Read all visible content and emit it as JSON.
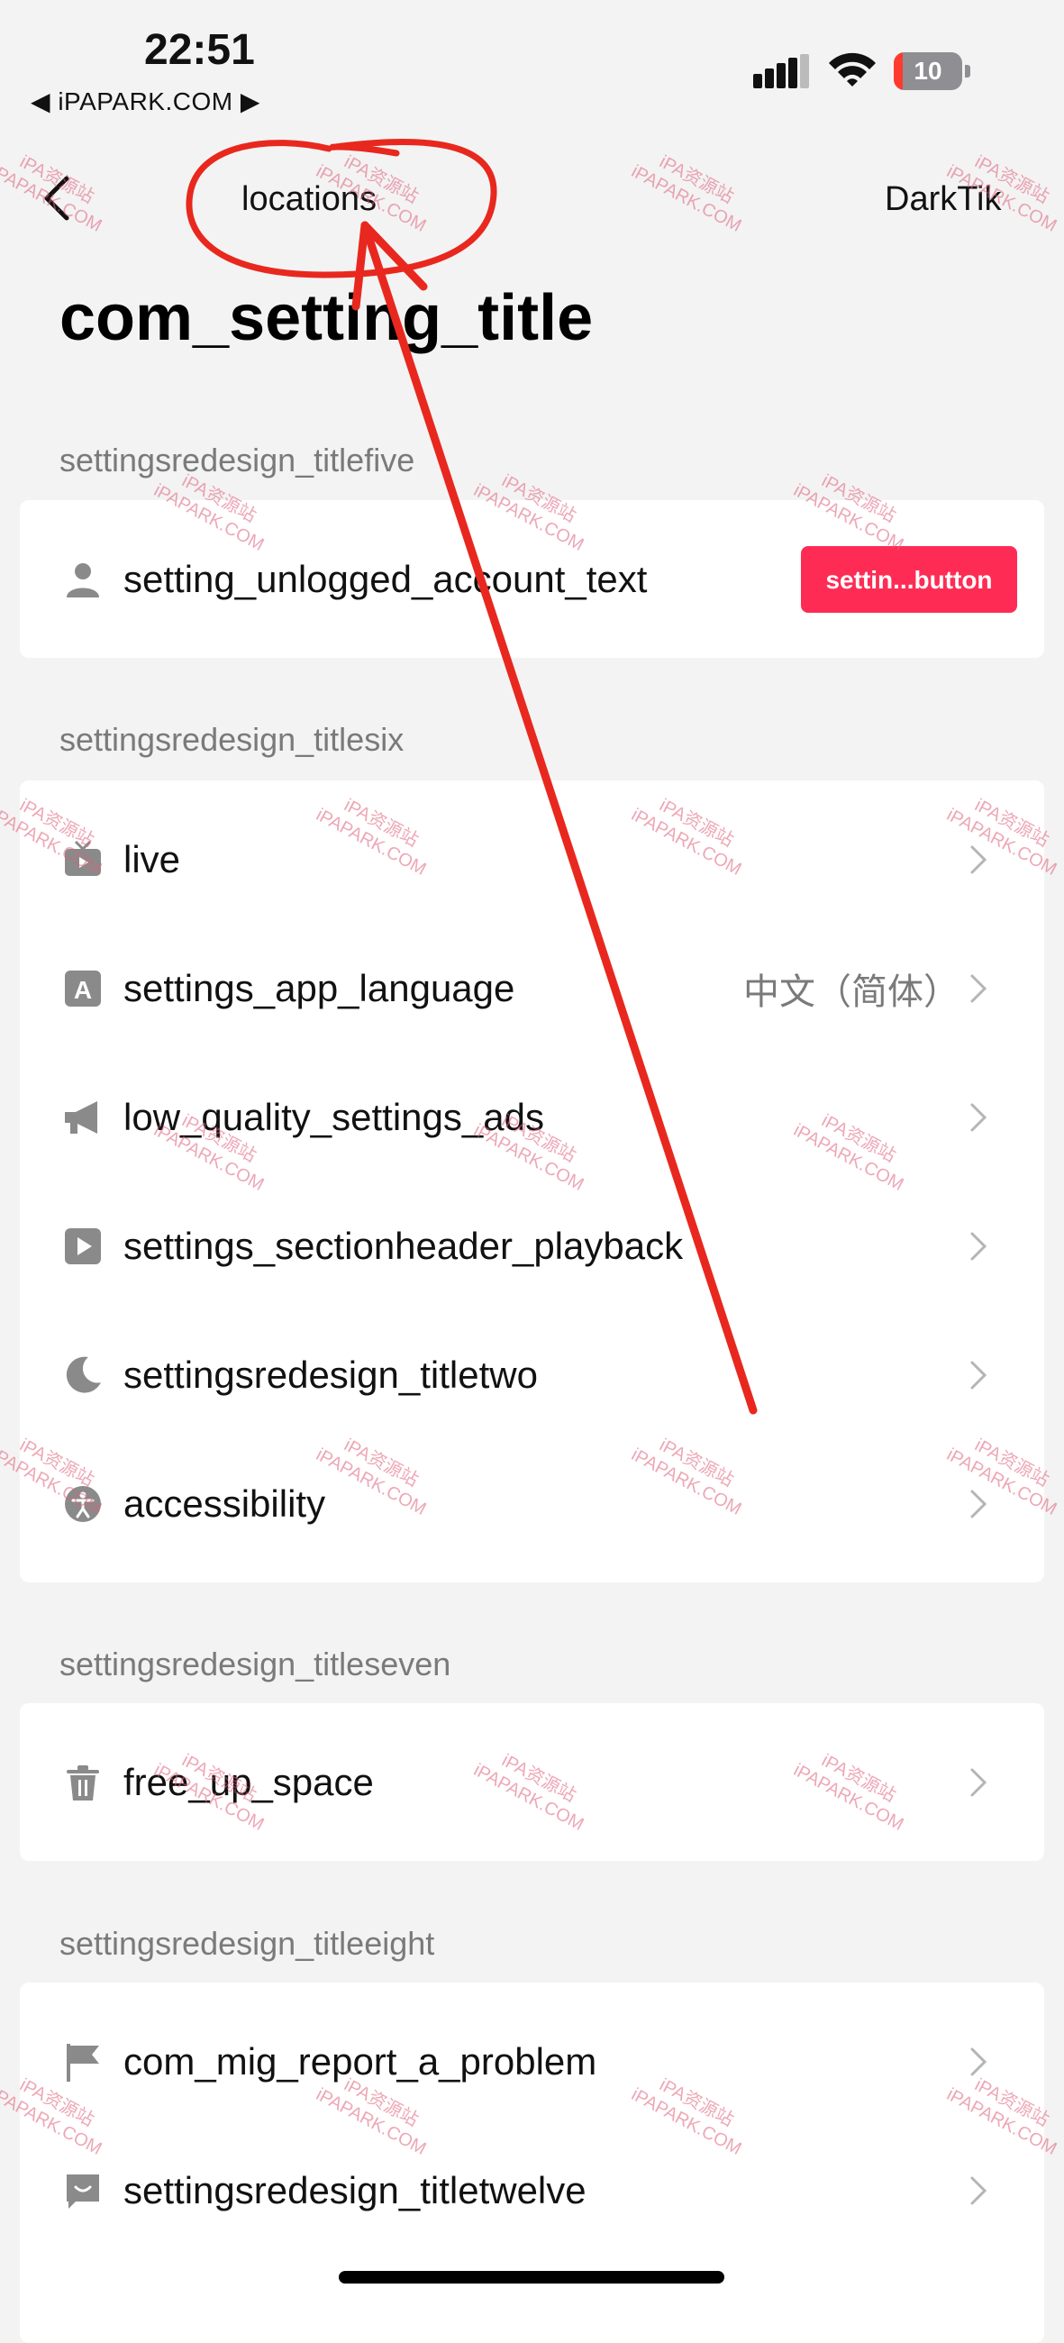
{
  "status_bar": {
    "time": "22:51",
    "carrier": "◀ iPAPARK.COM ▶",
    "battery": "10"
  },
  "nav": {
    "back_icon": "chevron-left-icon",
    "location": "locations",
    "right": "DarkTik"
  },
  "page_title": "com_setting_title",
  "sections": {
    "account": {
      "header": "settingsredesign_titlefive",
      "row_label": "setting_unlogged_account_text",
      "row_icon": "person-icon",
      "button_label": "settin...button"
    },
    "content": {
      "header": "settingsredesign_titlesix",
      "items": [
        {
          "label": "live",
          "icon": "live-tv-icon",
          "value": ""
        },
        {
          "label": "settings_app_language",
          "icon": "language-icon",
          "value": "中文（简体）"
        },
        {
          "label": "low_quality_settings_ads",
          "icon": "megaphone-icon",
          "value": ""
        },
        {
          "label": "settings_sectionheader_playback",
          "icon": "play-icon",
          "value": ""
        },
        {
          "label": "settingsredesign_titletwo",
          "icon": "moon-icon",
          "value": ""
        },
        {
          "label": "accessibility",
          "icon": "accessibility-icon",
          "value": ""
        }
      ]
    },
    "storage": {
      "header": "settingsredesign_titleseven",
      "items": [
        {
          "label": "free_up_space",
          "icon": "trash-icon"
        }
      ]
    },
    "support": {
      "header": "settingsredesign_titleeight",
      "items": [
        {
          "label": "com_mig_report_a_problem",
          "icon": "flag-icon"
        },
        {
          "label": "settingsredesign_titletwelve",
          "icon": "message-icon"
        }
      ]
    }
  },
  "watermark": {
    "line1": "iPA资源站",
    "line2": "iPAPARK.COM"
  },
  "colors": {
    "accent": "#fe2c55",
    "background": "#f3f3f3",
    "annotation": "#e8281e"
  }
}
